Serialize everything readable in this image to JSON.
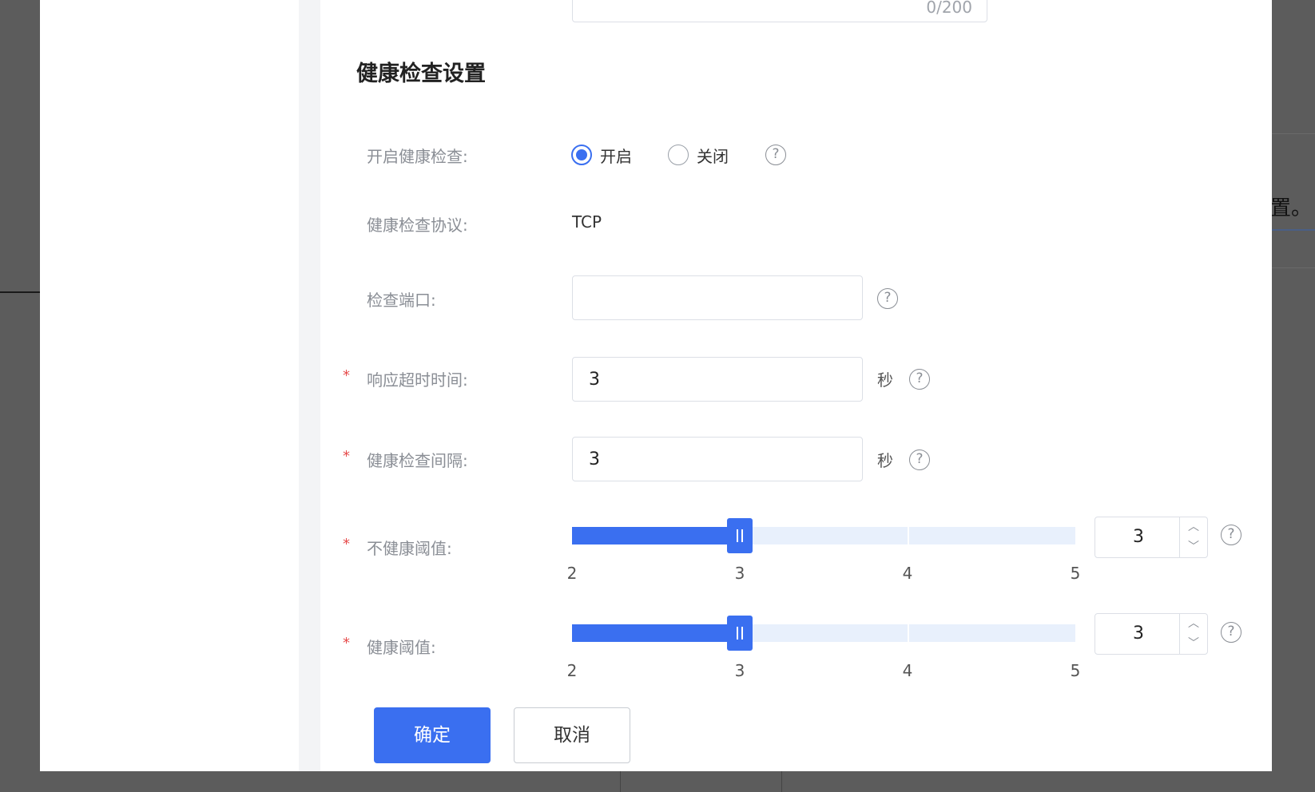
{
  "background": {
    "right_text": "置。"
  },
  "form": {
    "char_counter": "0/200",
    "section_title": "健康检查设置",
    "required_mark": "*",
    "enable_health_check": {
      "label": "开启健康检查:",
      "options": [
        {
          "label": "开启",
          "selected": true
        },
        {
          "label": "关闭",
          "selected": false
        }
      ]
    },
    "protocol": {
      "label": "健康检查协议:",
      "value": "TCP"
    },
    "check_port": {
      "label": "检查端口:",
      "value": ""
    },
    "response_timeout": {
      "label": "响应超时时间:",
      "value": "3",
      "unit": "秒"
    },
    "check_interval": {
      "label": "健康检查间隔:",
      "value": "3",
      "unit": "秒"
    },
    "unhealthy_threshold": {
      "label": "不健康阈值:",
      "value": "3",
      "min": 2,
      "max": 5,
      "ticks": [
        "2",
        "3",
        "4",
        "5"
      ]
    },
    "healthy_threshold": {
      "label": "健康阈值:",
      "value": "3",
      "min": 2,
      "max": 5,
      "ticks": [
        "2",
        "3",
        "4",
        "5"
      ]
    },
    "help_glyph": "?",
    "stepper_up": "︿",
    "stepper_down": "﹀"
  },
  "footer": {
    "confirm_label": "确定",
    "cancel_label": "取消"
  },
  "colors": {
    "primary": "#3a6ff0",
    "required": "#e64b4b",
    "track": "#e8f0fc"
  }
}
